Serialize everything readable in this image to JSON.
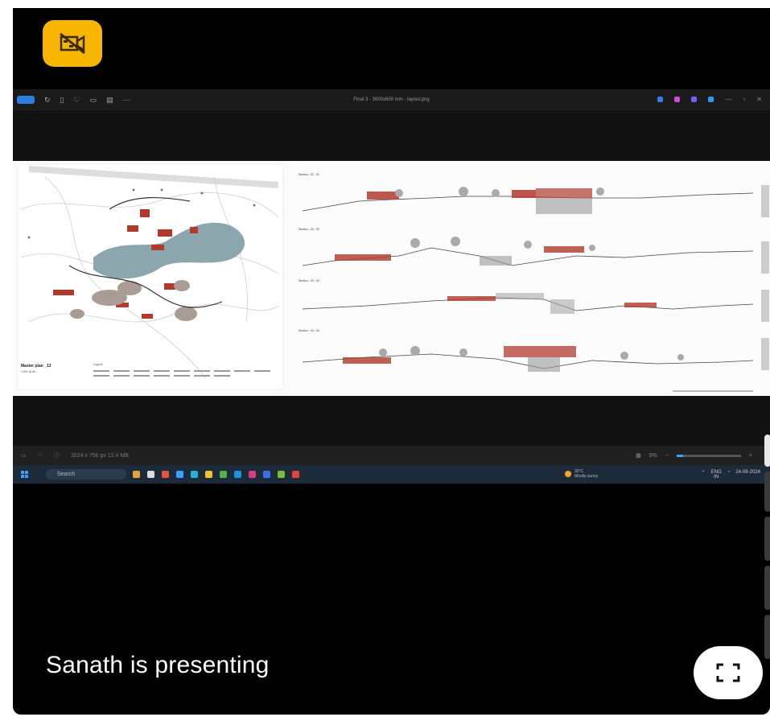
{
  "presenter_text": "Sanath is presenting",
  "camera_off_icon": "camera-off-icon",
  "fullscreen_icon": "fullscreen-icon",
  "shared_screen": {
    "window_title": "Final 3 - 3000x600 mm - layout.png",
    "toolbar_more": "···",
    "sheet": {
      "plan_title": "Master plan _13",
      "plan_subtitle": "1:500 @ A0",
      "legend_title": "Legend",
      "section_labels": [
        "Section - 01 - 01",
        "Section - 02 - 02",
        "Section - 03 - 03",
        "Section - 04 - 04"
      ]
    },
    "viewer_bar": {
      "file_info": "3024 x 756 px   12.4 MB",
      "zoom": "9%",
      "zoom_out": "−",
      "zoom_in": "+"
    },
    "taskbar": {
      "search_placeholder": "Search",
      "weather_temp": "30°C",
      "weather_desc": "Mostly sunny",
      "lang_line1": "ENG",
      "lang_line2": "IN",
      "time": "24-08-2024"
    }
  },
  "colors": {
    "badge": "#f7b500",
    "background": "#000000",
    "lake": "#8ba6ad",
    "building_red": "#b03a2e",
    "taskbar": "#1c2a3a"
  }
}
